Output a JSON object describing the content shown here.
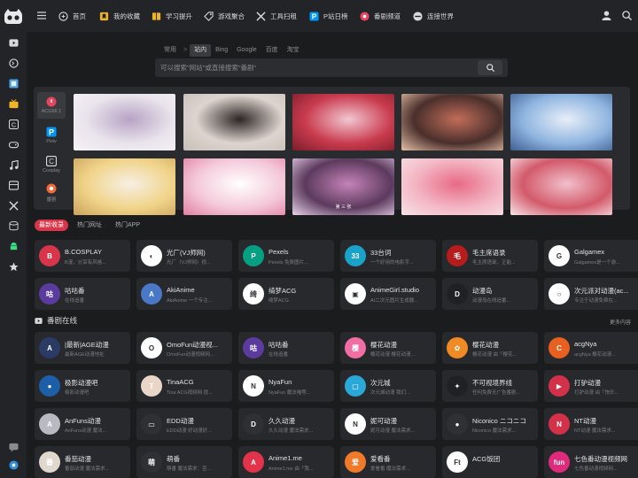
{
  "nav": {
    "items": [
      {
        "label": "首页",
        "icon": "home-icon"
      },
      {
        "label": "我的收藏",
        "icon": "bookmark-icon"
      },
      {
        "label": "学习提升",
        "icon": "book-icon"
      },
      {
        "label": "游戏聚合",
        "icon": "tag-icon"
      },
      {
        "label": "工具扫租",
        "icon": "tools-icon"
      },
      {
        "label": "P站日榜",
        "icon": "pixiv-icon"
      },
      {
        "label": "番剧频道",
        "icon": "bilibili-icon"
      },
      {
        "label": "连接世界",
        "icon": "world-icon"
      }
    ]
  },
  "search": {
    "tabs": [
      "常用",
      "站内",
      "Bing",
      "Google",
      "百度",
      "淘宝"
    ],
    "separator": ">",
    "active_tab": "站内",
    "placeholder": "可以搜索\"网站\"或直接搜索\"番剧\""
  },
  "gallery": {
    "sources": [
      {
        "label": "ACG66 1",
        "active": true
      },
      {
        "label": "Pixiv",
        "active": false
      },
      {
        "label": "Cosplay",
        "active": false
      },
      {
        "label": "番剧",
        "active": false
      }
    ],
    "thumbs": [
      {
        "c1": "#e9e4ec",
        "c2": "#b8a2c4",
        "c3": "#f6f1f3"
      },
      {
        "c1": "#ded4cf",
        "c2": "#2b2624",
        "c3": "#c7bfb8"
      },
      {
        "c1": "#c93b4e",
        "c2": "#f1c7d1",
        "c3": "#7b1d2a"
      },
      {
        "c1": "#4a2f2b",
        "c2": "#c26d5a",
        "c3": "#e7c0a8"
      },
      {
        "c1": "#8fb5e0",
        "c2": "#e8eef8",
        "c3": "#3f5e93"
      },
      {
        "c1": "#f1d48a",
        "c2": "#f6efe4",
        "c3": "#caa25b"
      },
      {
        "c1": "#f4c9d9",
        "c2": "#ffffff",
        "c3": "#e27fa3"
      },
      {
        "c1": "#5c3a5e",
        "c2": "#c583b8",
        "c3": "#e9d2ea"
      },
      {
        "c1": "#f3b7c4",
        "c2": "#e86a86",
        "c3": "#f7e3e8"
      },
      {
        "c1": "#d25a6a",
        "c2": "#f2bfcb",
        "c3": "#f9e5ea"
      }
    ],
    "caption": "第 三 张"
  },
  "category_tabs": [
    {
      "label": "最新收录",
      "active": true
    },
    {
      "label": "热门网址",
      "active": false
    },
    {
      "label": "热门APP",
      "active": false
    }
  ],
  "latest_cards": [
    {
      "title": "B.COSPLAY",
      "desc": "B漫，分享有风格...",
      "bg": "#d9354a",
      "glyph": "B"
    },
    {
      "title": "光厂(VJ师网)",
      "desc": "光厂（VJ师网）视...",
      "bg": "#ffffff",
      "glyph": "◐"
    },
    {
      "title": "Pexels",
      "desc": "Pexels 免费图片...",
      "bg": "#05a081",
      "glyph": "P"
    },
    {
      "title": "33台词",
      "desc": "一个好用的电影字...",
      "bg": "#19a3c9",
      "glyph": "33"
    },
    {
      "title": "毛主席语录",
      "desc": "毛主席语录，正能...",
      "bg": "#b71c1c",
      "glyph": "毛"
    },
    {
      "title": "Galgamex",
      "desc": "Galgamex是一个游...",
      "bg": "#ffffff",
      "glyph": "G"
    },
    {
      "title": "咕咕番",
      "desc": "在线追番",
      "bg": "#5b3b9e",
      "glyph": "咕"
    },
    {
      "title": "AkiAnime",
      "desc": "AkiAnime 一个专注...",
      "bg": "#4a78c9",
      "glyph": "A"
    },
    {
      "title": "绮梦ACG",
      "desc": "绮梦ACG",
      "bg": "#ffffff",
      "glyph": "绮"
    },
    {
      "title": "AnimeGirl.studio",
      "desc": "AI二次元图片生成器...",
      "bg": "#ffffff",
      "glyph": "▣"
    },
    {
      "title": "动漫岛",
      "desc": "动漫岛在线追番...",
      "bg": "#1f2125",
      "glyph": "D"
    },
    {
      "title": "次元派对动漫(ac...",
      "desc": "专注于动漫免费在...",
      "bg": "#ffffff",
      "glyph": "○"
    }
  ],
  "section": {
    "title": "番剧在线",
    "more": "更多内容"
  },
  "anime_cards": [
    {
      "title": "|最新|AGE动漫",
      "desc": "最新AGE动漫地址",
      "bg": "#2c3a66",
      "glyph": "A"
    },
    {
      "title": "OmoFun动漫视...",
      "desc": "OmoFun动漫视频网...",
      "bg": "#ffffff",
      "glyph": "O"
    },
    {
      "title": "咕咕番",
      "desc": "在线追番",
      "bg": "#5b3b9e",
      "glyph": "咕"
    },
    {
      "title": "樱花动漫",
      "desc": "樱花动漫 樱花动漫...",
      "bg": "#f06ea3",
      "glyph": "樱"
    },
    {
      "title": "樱花动漫",
      "desc": "樱花动漫 由「樱花...",
      "bg": "#f08a24",
      "glyph": "✿"
    },
    {
      "title": "acgNya",
      "desc": "acgNya 樱花动漫...",
      "bg": "#e8601f",
      "glyph": "C"
    },
    {
      "title": "极影动漫吧",
      "desc": "极影动漫吧",
      "bg": "#1c5fa6",
      "glyph": "●"
    },
    {
      "title": "TinaACG",
      "desc": "Tina ACG视频网 提...",
      "bg": "#ead6c9",
      "glyph": "T"
    },
    {
      "title": "NyaFun",
      "desc": "NyaFun 魔法喵等...",
      "bg": "#ffffff",
      "glyph": "N"
    },
    {
      "title": "次元城",
      "desc": "次元城动漫 我们...",
      "bg": "#2aa9d8",
      "glyph": "▢"
    },
    {
      "title": "不可视境界线",
      "desc": "任何免费无广告番剧...",
      "bg": "#1f2125",
      "glyph": "✦"
    },
    {
      "title": "打驴动漫",
      "desc": "打驴动漫 由「快乐...",
      "bg": "#d3304a",
      "glyph": "▶"
    },
    {
      "title": "AnFuns动漫",
      "desc": "AnFuns动漫 魔法...",
      "bg": "#b9b9c2",
      "glyph": "A"
    },
    {
      "title": "EDD动漫",
      "desc": "EDD动漫 好动漫好...",
      "bg": "#2f3034",
      "glyph": "▭"
    },
    {
      "title": "久久动漫",
      "desc": "久久动漫 魔法需求...",
      "bg": "#2f3034",
      "glyph": "D"
    },
    {
      "title": "妮可动漫",
      "desc": "妮可动漫 魔法需求...",
      "bg": "#ffffff",
      "glyph": "N"
    },
    {
      "title": "Niconico ニコニコ",
      "desc": "Niconico 魔法需求...",
      "bg": "#2f3034",
      "glyph": "●"
    },
    {
      "title": "NT动漫",
      "desc": "NT动漫 魔法需求...",
      "bg": "#d3304a",
      "glyph": "N"
    },
    {
      "title": "番茄动漫",
      "desc": "番茄动漫 魔法需求...",
      "bg": "#e0d7cf",
      "glyph": "番"
    },
    {
      "title": "萌番",
      "desc": "萌番 魔法需求：否...",
      "bg": "#2f3034",
      "glyph": "萌"
    },
    {
      "title": "Anime1.me",
      "desc": "Anime1.me 由「我...",
      "bg": "#e3334a",
      "glyph": "A"
    },
    {
      "title": "爱看番",
      "desc": "爱看番 魔法需求...",
      "bg": "#f07a2a",
      "glyph": "爱"
    },
    {
      "title": "ACG饭团",
      "desc": "",
      "bg": "#ffffff",
      "glyph": "Ft"
    },
    {
      "title": "七色番动漫视频网",
      "desc": "七色番动漫视频网...",
      "bg": "#e02a7c",
      "glyph": "fun"
    }
  ],
  "colors": {
    "accent": "#d9354a",
    "bg": "#1b1c1e",
    "panel": "#2a2b2e",
    "card": "#28292c"
  }
}
